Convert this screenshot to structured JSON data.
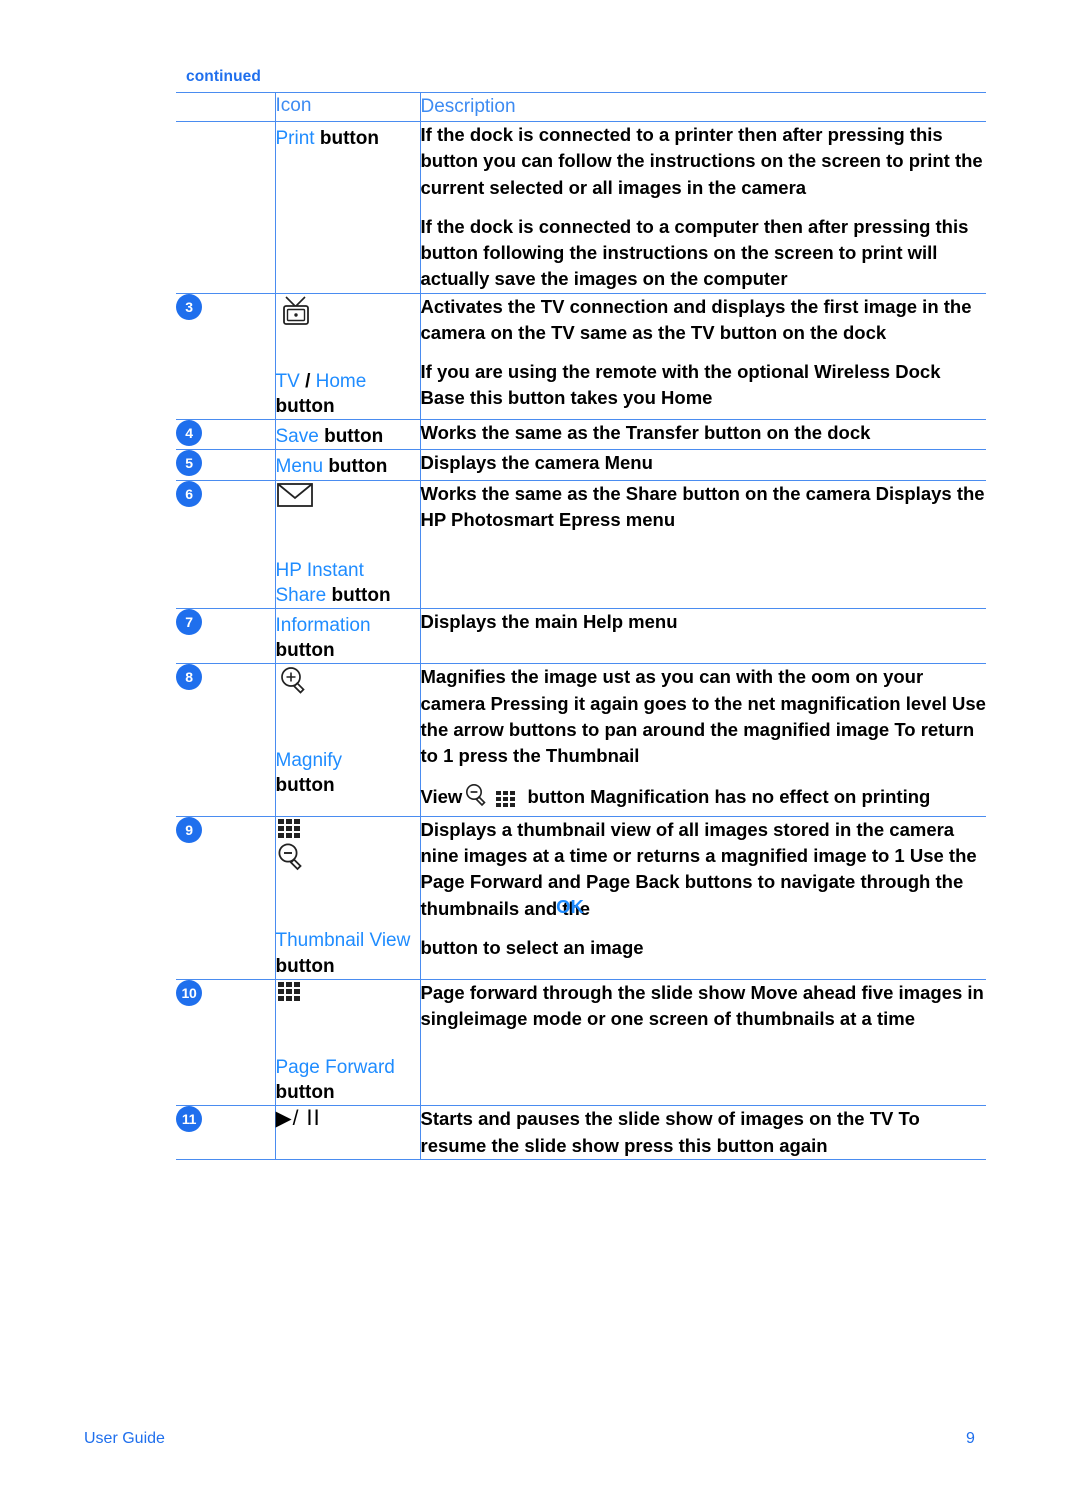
{
  "document": {
    "continued_label": "continued",
    "footer_left": "User Guide",
    "page_number": "9"
  },
  "colors": {
    "accent_blue": "#1f8cff",
    "rule_blue": "#4a8cf0",
    "badge_blue": "#1f6fed",
    "text_black": "#000000"
  },
  "table": {
    "headers": {
      "number": "",
      "icon": "Icon",
      "description": "Description"
    },
    "rows": [
      {
        "number": "",
        "icon_name": "",
        "icon_label_blue": "Print",
        "icon_label_black": "button",
        "paragraphs": [
          "If the dock is connected to a printer then after pressing this button you can follow the instructions on the screen to print the current selected or all images in the camera",
          "If the dock is connected to a computer then after pressing this button following the instructions on the screen to print will actually save the images on the computer"
        ]
      },
      {
        "number": "3",
        "icon_name": "tv-icon",
        "icon_label_blue": "TV",
        "icon_label_sep": "/",
        "icon_label_blue2": "Home",
        "icon_label_black": "button",
        "paragraphs": [
          "Activates the TV connection and displays the first image in the camera on the TV same as the TV button on the dock",
          "If you are using the remote with the optional Wireless Dock Base this button takes you Home"
        ]
      },
      {
        "number": "4",
        "icon_name": "",
        "icon_label_blue": "Save",
        "icon_label_black": "button",
        "paragraphs": [
          "Works the same as the Transfer button on the dock"
        ]
      },
      {
        "number": "5",
        "icon_name": "",
        "icon_label_blue": "Menu",
        "icon_label_black": "button",
        "paragraphs": [
          "Displays the camera Menu"
        ]
      },
      {
        "number": "6",
        "icon_name": "envelope-icon",
        "icon_label_blue": "HP Instant Share",
        "icon_label_black": "button",
        "paragraphs": [
          "Works the same as the Share button on the camera Displays the HP Photosmart Epress menu"
        ]
      },
      {
        "number": "7",
        "icon_name": "",
        "icon_label_blue": "Information",
        "icon_label_black": "button",
        "paragraphs": [
          "Displays the main Help menu"
        ]
      },
      {
        "number": "8",
        "icon_name": "magnify-plus-icon",
        "icon_label_blue": "Magnify",
        "icon_label_black": "button",
        "paragraphs": [
          "Magnifies the image ust as you can with the oom on your camera Pressing it again goes to the net magnification level Use the arrow buttons to pan around the magnified image To return to 1 press the Thumbnail",
          "View"
        ],
        "para2_tail": "button Magnification has no effect on printing"
      },
      {
        "number": "9",
        "icon_name": "thumbnail-view-icon",
        "icon_label_blue": "Thumbnail View",
        "icon_label_black": "button",
        "paragraphs": [
          "Displays a thumbnail view of all images stored in the camera nine images at a time or returns a magnified image to 1 Use the Page Forward and Page Back buttons to navigate through the thumbnails and the",
          "button to select an image"
        ],
        "overlap_text": "OK"
      },
      {
        "number": "10",
        "icon_name": "grid-icon",
        "icon_label_blue": "Page Forward",
        "icon_label_black": "button",
        "paragraphs": [
          "Page forward through the slide show Move ahead five images in singleimage mode or one screen of thumbnails at a time"
        ]
      },
      {
        "number": "11",
        "icon_name": "play-pause-icon",
        "icon_glyph": "▶/ ⅠⅠ",
        "icon_label_blue": "",
        "icon_label_black": "",
        "paragraphs": [
          "Starts and pauses the slide show of images on the TV To resume the slide show press this button again"
        ]
      }
    ]
  }
}
